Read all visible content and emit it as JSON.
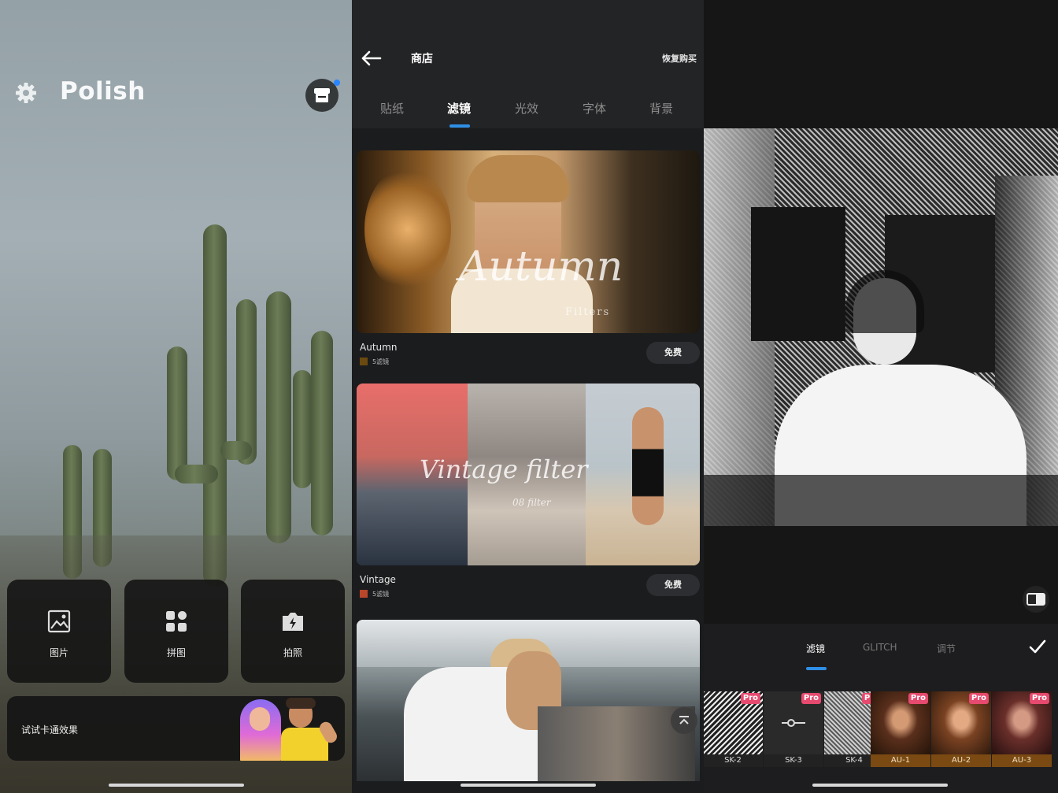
{
  "home": {
    "logo": "Polish",
    "actions": [
      {
        "label": "图片",
        "icon": "image-icon"
      },
      {
        "label": "拼图",
        "icon": "collage-grid-icon"
      },
      {
        "label": "拍照",
        "icon": "camera-icon"
      }
    ],
    "cartoon_banner": "试试卡通效果",
    "icons": {
      "settings": "gear-icon",
      "store": "store-icon"
    },
    "notification_color": "#2a86ff"
  },
  "store": {
    "title": "商店",
    "restore": "恢复购买",
    "tabs": [
      "贴纸",
      "滤镜",
      "光效",
      "字体",
      "背景"
    ],
    "active_tab": "滤镜",
    "packs": [
      {
        "name": "Autumn",
        "count": "5滤镜",
        "price": "免费",
        "swatch": "#6b4a10",
        "overlay": "Autumn",
        "overlay_sub": "Filters"
      },
      {
        "name": "Vintage",
        "count": "5滤镜",
        "price": "免费",
        "swatch": "#b8462a",
        "overlay": "Vintage filter",
        "overlay_sub": "08 filter"
      }
    ],
    "accent": "#2f8fe6"
  },
  "editor": {
    "tabs": [
      "滤镜",
      "GLITCH",
      "调节"
    ],
    "active_tab": "滤镜",
    "filters": [
      {
        "label": "SK-2",
        "pro": "Pro"
      },
      {
        "label": "SK-3",
        "pro": "Pro"
      },
      {
        "label": "SK-4",
        "pro": "Pro"
      },
      {
        "label": "AU-1",
        "pro": "Pro"
      },
      {
        "label": "AU-2",
        "pro": "Pro"
      },
      {
        "label": "AU-3",
        "pro": "Pro"
      }
    ],
    "pro_color": "#e64a6f"
  }
}
